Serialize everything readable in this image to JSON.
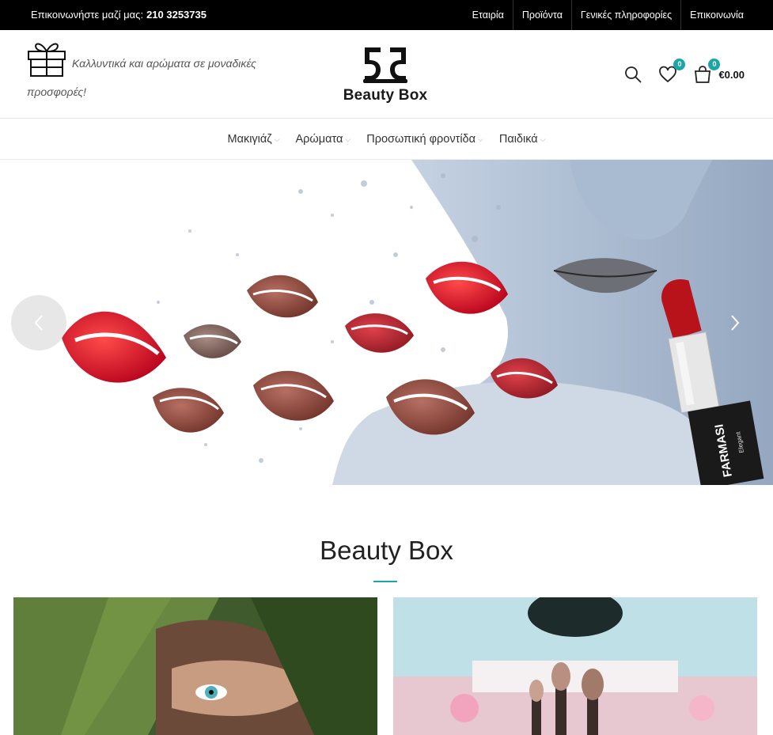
{
  "topbar": {
    "contact_label": "Επικοινωνήστε μαζί μας:",
    "phone": "210 3253735",
    "links": [
      "Εταιρία",
      "Προϊόντα",
      "Γενικές πληροφορίες",
      "Επικοινωνία"
    ]
  },
  "header": {
    "tagline": "Καλλυντικά και αρώματα σε μοναδικές προσφορές!",
    "logo_text": "Beauty Box",
    "wishlist_count": "0",
    "cart_count": "0",
    "cart_total": "€0.00"
  },
  "nav": {
    "items": [
      "Μακιγιάζ",
      "Αρώματα",
      "Προσωπική φροντίδα",
      "Παιδικά"
    ]
  },
  "hero": {
    "product_brand": "FARMASI",
    "product_line": "Elegant"
  },
  "section": {
    "title": "Beauty Box"
  },
  "colors": {
    "accent": "#1aa6a6",
    "topbar_bg": "#000000"
  },
  "icons": {
    "search": "search-icon",
    "wishlist": "heart-icon",
    "cart": "shopping-bag-icon",
    "gift": "gift-icon"
  }
}
